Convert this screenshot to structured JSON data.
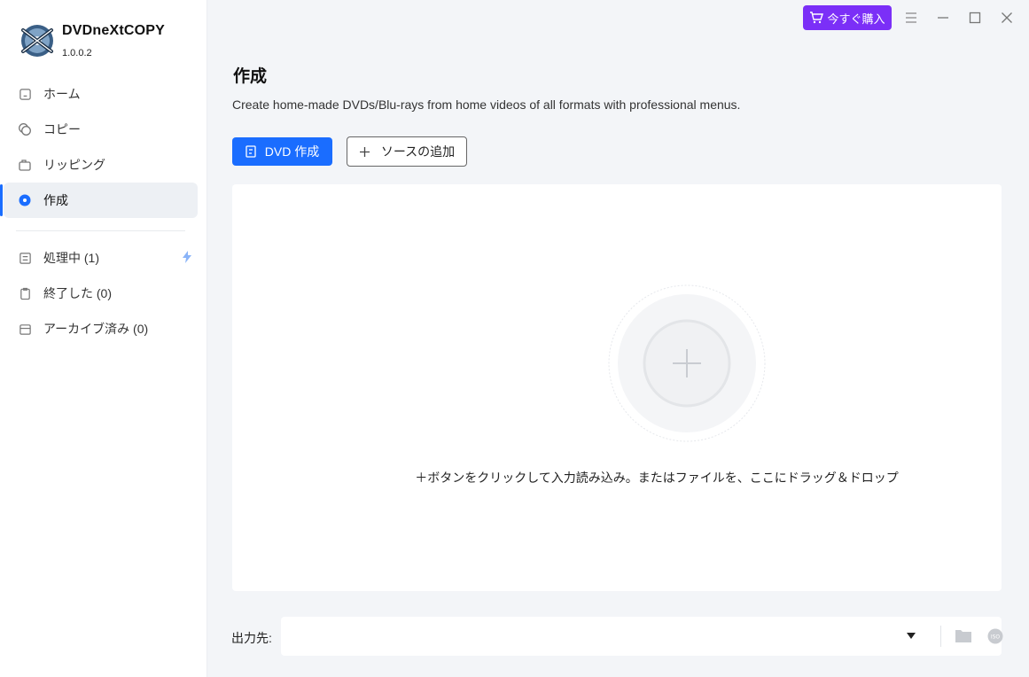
{
  "app": {
    "name": "DVDneXtCOPY",
    "version": "1.0.0.2"
  },
  "sidebar": {
    "items": [
      {
        "label": "ホーム",
        "icon": "home-icon"
      },
      {
        "label": "コピー",
        "icon": "copy-disc-icon"
      },
      {
        "label": "リッピング",
        "icon": "ripping-icon"
      },
      {
        "label": "作成",
        "icon": "create-disc-icon",
        "active": true
      }
    ],
    "tasks": [
      {
        "label": "処理中 (1)",
        "icon": "processing-list-icon"
      },
      {
        "label": "終了した (0)",
        "icon": "clipboard-icon"
      },
      {
        "label": "アーカイブ済み (0)",
        "icon": "archive-icon"
      }
    ]
  },
  "topbar": {
    "buy_label": "今すぐ購入"
  },
  "page": {
    "title": "作成",
    "description": "Create home-made DVDs/Blu-rays from home videos of all formats with professional menus.",
    "primary_button": "DVD 作成",
    "add_source_button": "ソースの追加",
    "drop_hint": "＋ボタンをクリックして入力読み込み。またはファイルを、ここにドラッグ＆ドロップ"
  },
  "output": {
    "label": "出力先:",
    "value": ""
  },
  "colors": {
    "accent": "#1a6dff",
    "buy": "#7b2ff7"
  }
}
